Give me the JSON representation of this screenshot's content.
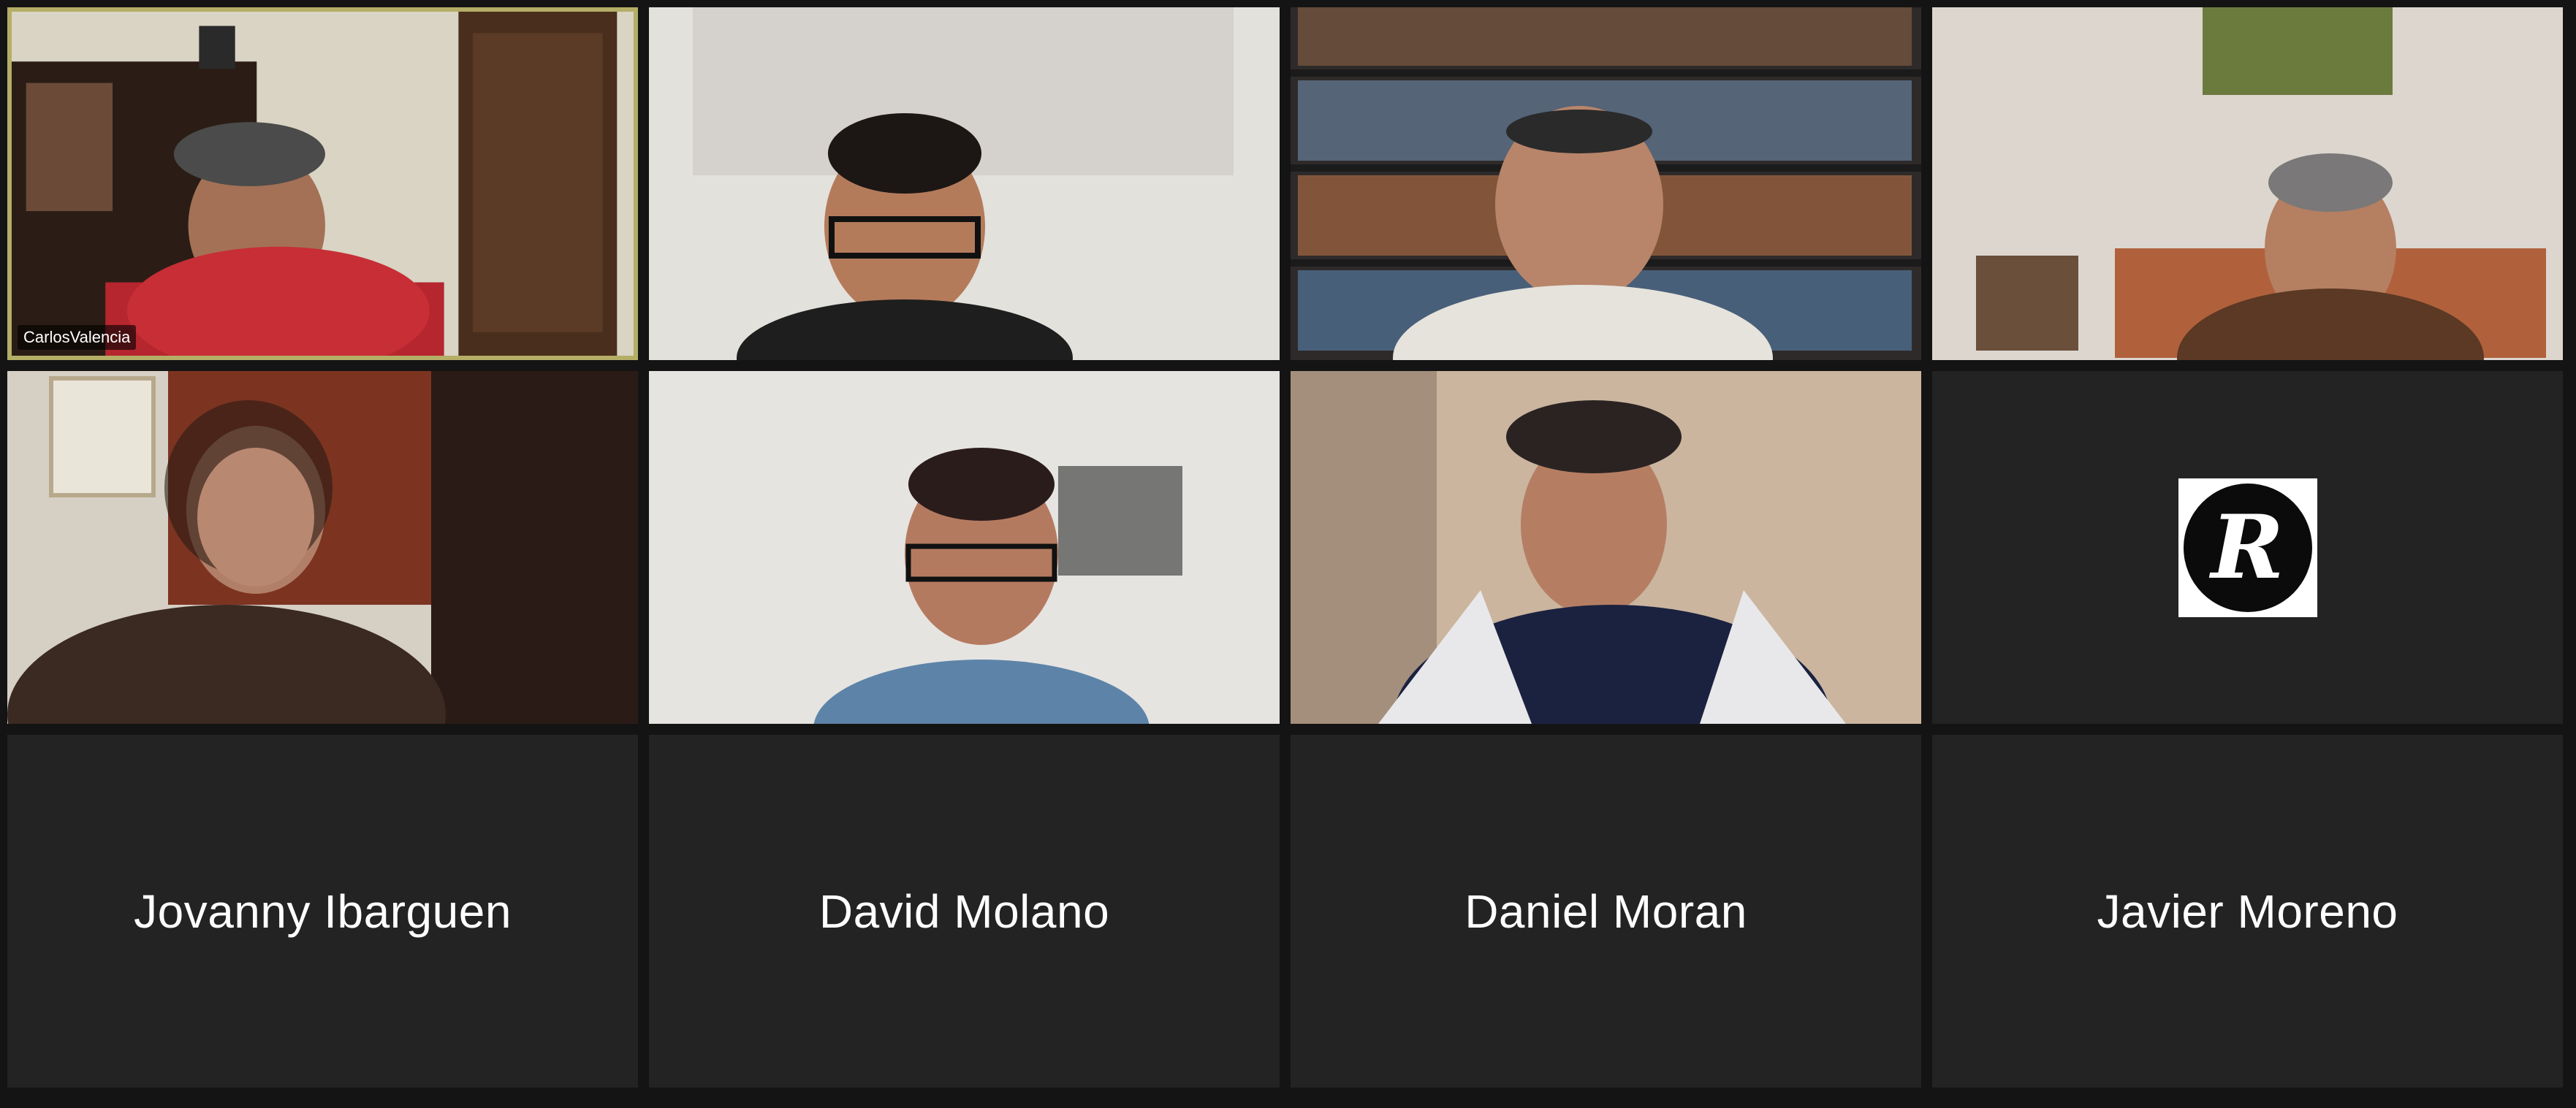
{
  "meeting": {
    "view": "gallery",
    "participants": [
      {
        "name": "CarlosValencia",
        "video": true,
        "active_speaker": true,
        "show_tag": true
      },
      {
        "name": "",
        "video": true
      },
      {
        "name": "",
        "video": true
      },
      {
        "name": "",
        "video": true
      },
      {
        "name": "",
        "video": true
      },
      {
        "name": "",
        "video": true
      },
      {
        "name": "",
        "video": true
      },
      {
        "name": "",
        "video": false,
        "avatar_logo": "R"
      },
      {
        "name": "Jovanny Ibarguen",
        "video": false
      },
      {
        "name": "David Molano",
        "video": false
      },
      {
        "name": "Daniel Moran",
        "video": false
      },
      {
        "name": "Javier Moreno",
        "video": false
      }
    ]
  },
  "colors": {
    "background": "#141414",
    "tile": "#232323",
    "active_speaker_border": "#b4ae67",
    "name_text": "#ffffff"
  }
}
